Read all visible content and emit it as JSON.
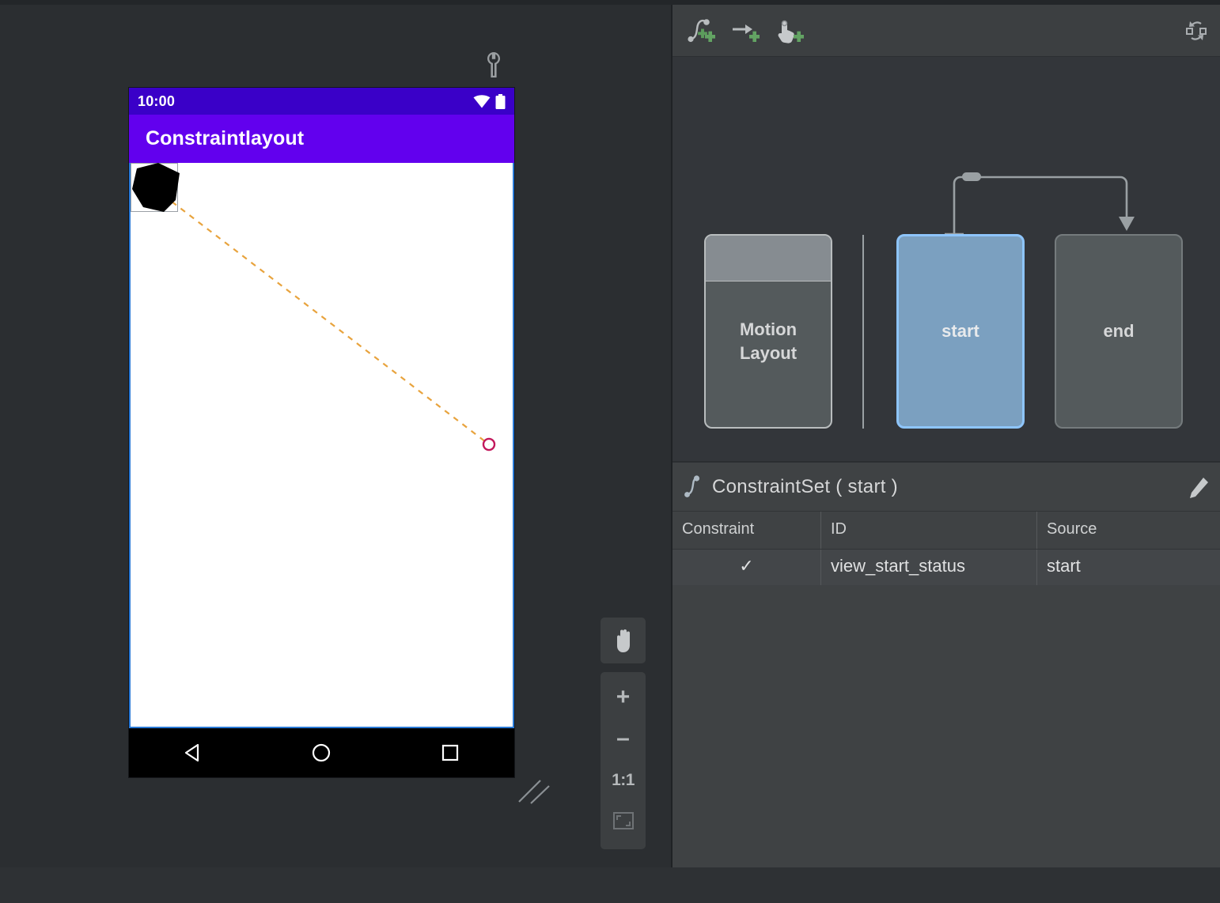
{
  "app": {
    "surface_tool_icon": "wrench-icon"
  },
  "device_preview": {
    "status_bar": {
      "time": "10:00",
      "icons": [
        "wifi-icon",
        "battery-icon"
      ]
    },
    "app_bar": {
      "title": "Constraintlayout"
    },
    "canvas": {
      "widget_name": "black-polygon-widget",
      "path_type": "dashed-motion-path",
      "path_color": "#e8a33d",
      "start_marker_color": "#c2185b",
      "end_marker_color": "#c2185b"
    },
    "nav_bar": {
      "back_label": "back-icon",
      "home_label": "home-icon",
      "recents_label": "recents-icon"
    }
  },
  "zoom_controls": {
    "pan_label": "hand-pan-icon",
    "zoom_in_label": "+",
    "zoom_out_label": "–",
    "actual_size_label": "1:1",
    "fit_label": "zoom-to-fit-icon"
  },
  "motion_toolbar": {
    "items": [
      {
        "name": "add-constraintset-button",
        "label": "create-constraintset-icon"
      },
      {
        "name": "add-transition-button",
        "label": "create-transition-icon"
      },
      {
        "name": "add-onclick-button",
        "label": "create-click-handler-icon"
      }
    ],
    "right_action": {
      "name": "convert-to-motionlayout-button",
      "label": "cycle-icon"
    }
  },
  "overview": {
    "motion_layout_card": {
      "label_line1": "Motion",
      "label_line2": "Layout",
      "selected": false
    },
    "states": [
      {
        "label": "start",
        "selected": true
      },
      {
        "label": "end",
        "selected": false
      }
    ],
    "transition": {
      "from": "start",
      "to": "end",
      "color": "#9aa0a3"
    },
    "accent_selected": "#8ec5fb"
  },
  "constraint_set": {
    "title": "ConstraintSet (  start  )",
    "icon": "motion-curve-icon",
    "edit_icon": "pencil-icon",
    "columns": [
      "Constraint",
      "ID",
      "Source"
    ],
    "rows": [
      {
        "constraint": "✓",
        "id": "view_start_status",
        "source": "start"
      }
    ]
  }
}
